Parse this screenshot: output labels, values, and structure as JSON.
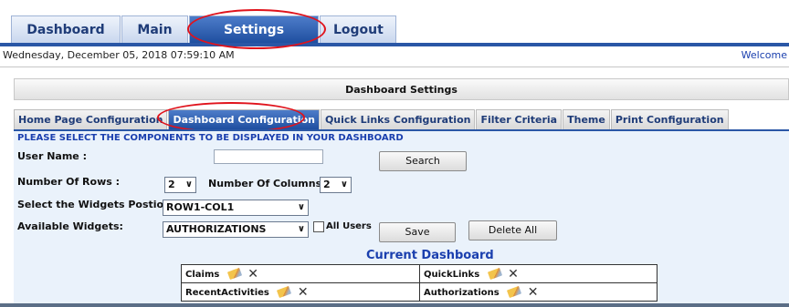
{
  "topnav": {
    "tabs": [
      {
        "label": "Dashboard"
      },
      {
        "label": "Main"
      },
      {
        "label": "Settings",
        "active": true
      },
      {
        "label": "Logout"
      }
    ]
  },
  "header": {
    "datetime": "Wednesday, December 05, 2018 07:59:10 AM",
    "welcome": "Welcome"
  },
  "settings_title": "Dashboard Settings",
  "subtabs": [
    {
      "label": "Home Page Configuration"
    },
    {
      "label": "Dashboard Configuration",
      "active": true
    },
    {
      "label": "Quick Links Configuration"
    },
    {
      "label": "Filter Criteria"
    },
    {
      "label": "Theme"
    },
    {
      "label": "Print Configuration"
    }
  ],
  "form": {
    "instruction": "PLEASE SELECT THE COMPONENTS TO BE DISPLAYED IN YOUR DASHBOARD",
    "username_label": "User Name :",
    "username_value": "",
    "search_label": "Search",
    "rows_label": "Number Of Rows :",
    "rows_value": "2",
    "columns_label": "Number Of Columns :",
    "columns_value": "2",
    "position_label": "Select the Widgets Postion:",
    "position_value": "ROW1-COL1",
    "widgets_label": "Available Widgets:",
    "widgets_value": "AUTHORIZATIONS",
    "allusers_label": "All Users",
    "save_label": "Save",
    "deleteall_label": "Delete All"
  },
  "current_dashboard": {
    "title": "Current Dashboard",
    "widgets": [
      [
        "Claims",
        "QuickLinks"
      ],
      [
        "RecentActivities",
        "Authorizations"
      ]
    ]
  },
  "icons": {
    "edit": "pencil-icon",
    "remove": "close-icon"
  },
  "colors": {
    "accent": "#2a57a6",
    "highlight": "#e0131c",
    "link": "#1a3fae"
  }
}
